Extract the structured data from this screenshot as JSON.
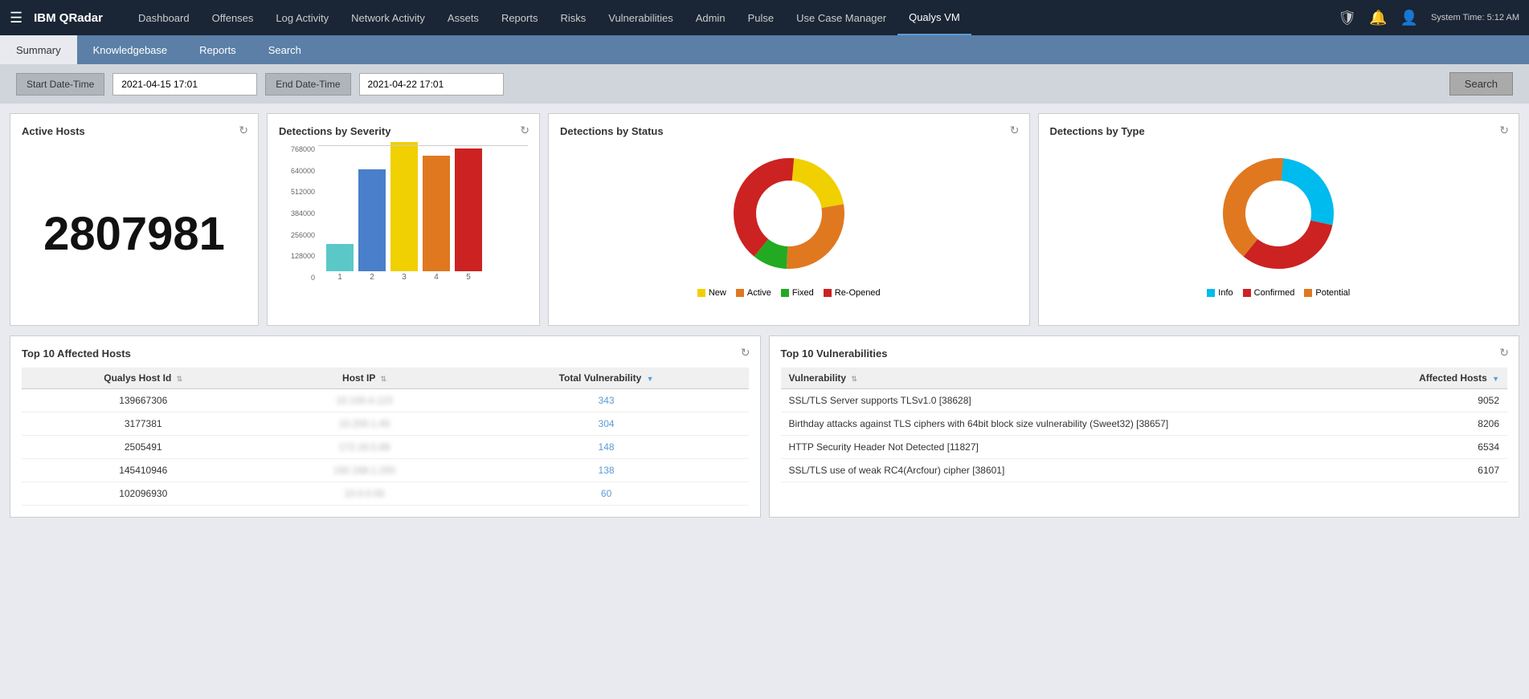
{
  "app": {
    "brand": "IBM QRadar",
    "system_time_label": "System Time: 5:12 AM"
  },
  "top_nav": {
    "items": [
      {
        "label": "Dashboard",
        "active": false
      },
      {
        "label": "Offenses",
        "active": false
      },
      {
        "label": "Log Activity",
        "active": false
      },
      {
        "label": "Network Activity",
        "active": false
      },
      {
        "label": "Assets",
        "active": false
      },
      {
        "label": "Reports",
        "active": false
      },
      {
        "label": "Risks",
        "active": false
      },
      {
        "label": "Vulnerabilities",
        "active": false
      },
      {
        "label": "Admin",
        "active": false
      },
      {
        "label": "Pulse",
        "active": false
      },
      {
        "label": "Use Case Manager",
        "active": false
      },
      {
        "label": "Qualys VM",
        "active": true
      }
    ]
  },
  "secondary_nav": {
    "tabs": [
      {
        "label": "Summary",
        "active": true
      },
      {
        "label": "Knowledgebase",
        "active": false
      },
      {
        "label": "Reports",
        "active": false
      },
      {
        "label": "Search",
        "active": false
      }
    ]
  },
  "datetime_bar": {
    "start_label": "Start Date-Time",
    "start_value": "2021-04-15 17:01",
    "end_label": "End Date-Time",
    "end_value": "2021-04-22 17:01",
    "search_label": "Search"
  },
  "active_hosts": {
    "title": "Active Hosts",
    "value": "2807981"
  },
  "detections_severity": {
    "title": "Detections by Severity",
    "y_labels": [
      "768000",
      "640000",
      "512000",
      "384000",
      "256000",
      "128000",
      "0"
    ],
    "bars": [
      {
        "label": "1",
        "color": "#5bc8c8",
        "height_pct": 20
      },
      {
        "label": "2",
        "color": "#4a7fcb",
        "height_pct": 75
      },
      {
        "label": "3",
        "color": "#f0d000",
        "height_pct": 95
      },
      {
        "label": "4",
        "color": "#e07820",
        "height_pct": 85
      },
      {
        "label": "5",
        "color": "#cc2222",
        "height_pct": 90
      }
    ]
  },
  "detections_status": {
    "title": "Detections by Status",
    "legend": [
      {
        "label": "New",
        "color": "#f0d000"
      },
      {
        "label": "Active",
        "color": "#e07820"
      },
      {
        "label": "Fixed",
        "color": "#22aa22"
      },
      {
        "label": "Re-Opened",
        "color": "#cc2222"
      }
    ],
    "segments": [
      {
        "color": "#f0d000",
        "pct": 22,
        "start": 0
      },
      {
        "color": "#e07820",
        "pct": 28,
        "start": 22
      },
      {
        "color": "#22aa22",
        "pct": 10,
        "start": 50
      },
      {
        "color": "#cc2222",
        "pct": 40,
        "start": 60
      }
    ]
  },
  "detections_type": {
    "title": "Detections by Type",
    "legend": [
      {
        "label": "Info",
        "color": "#00bbee"
      },
      {
        "label": "Confirmed",
        "color": "#cc2222"
      },
      {
        "label": "Potential",
        "color": "#e07820"
      }
    ],
    "segments": [
      {
        "color": "#00bbee",
        "pct": 28,
        "start": 0
      },
      {
        "color": "#cc2222",
        "pct": 32,
        "start": 28
      },
      {
        "color": "#e07820",
        "pct": 40,
        "start": 60
      }
    ]
  },
  "top_affected_hosts": {
    "title": "Top 10 Affected Hosts",
    "columns": [
      "Qualys Host Id",
      "Host IP",
      "Total Vulnerability"
    ],
    "rows": [
      {
        "host_id": "139667306",
        "host_ip": "██ █████ ███",
        "total": "343"
      },
      {
        "host_id": "3177381",
        "host_ip": "█████████ ██",
        "total": "304"
      },
      {
        "host_id": "2505491",
        "host_ip": "██ ████ ████",
        "total": "148"
      },
      {
        "host_id": "145410946",
        "host_ip": "███ ███ ██ ██",
        "total": "138"
      },
      {
        "host_id": "102096930",
        "host_ip": "████ ██ ███",
        "total": "60"
      }
    ]
  },
  "top_vulnerabilities": {
    "title": "Top 10 Vulnerabilities",
    "columns": [
      "Vulnerability",
      "Affected Hosts"
    ],
    "rows": [
      {
        "name": "SSL/TLS Server supports TLSv1.0 [38628]",
        "count": "9052"
      },
      {
        "name": "Birthday attacks against TLS ciphers with 64bit block size vulnerability (Sweet32) [38657]",
        "count": "8206"
      },
      {
        "name": "HTTP Security Header Not Detected [11827]",
        "count": "6534"
      },
      {
        "name": "SSL/TLS use of weak RC4(Arcfour) cipher [38601]",
        "count": "6107"
      }
    ]
  }
}
